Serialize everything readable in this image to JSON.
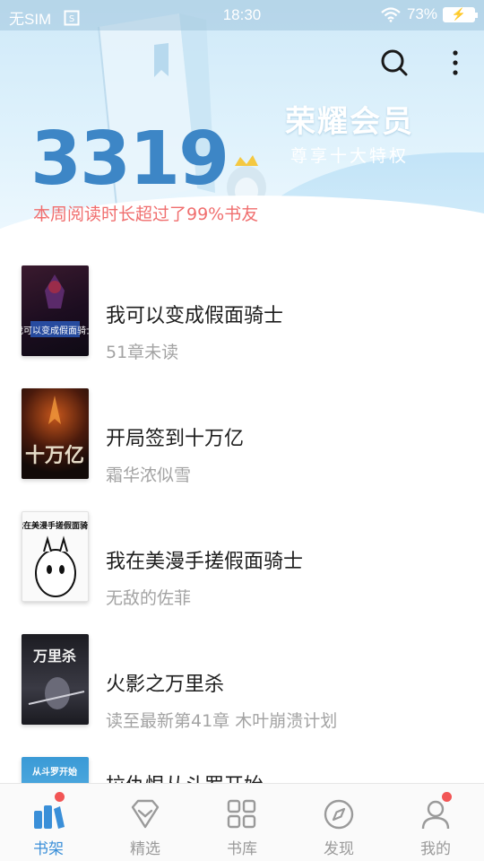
{
  "status_bar": {
    "carrier": "无SIM",
    "time": "18:30",
    "battery": "73%"
  },
  "header": {
    "vip_title": "荣耀会员",
    "vip_subtitle": "尊享十大特权",
    "reading_minutes": "3319",
    "reading_rank_text": "本周阅读时长超过了99%书友"
  },
  "books": [
    {
      "title": "我可以变成假面骑士",
      "subtitle": "51章未读",
      "cover_text": "我可以变成假面骑士"
    },
    {
      "title": "开局签到十万亿",
      "subtitle": "霜华浓似雪",
      "cover_text": "十万亿"
    },
    {
      "title": "我在美漫手搓假面骑士",
      "subtitle": "无敌的佐菲",
      "cover_text": "我在美漫手搓假面骑士"
    },
    {
      "title": "火影之万里杀",
      "subtitle": "读至最新第41章 木叶崩溃计划",
      "cover_text": "万里杀"
    },
    {
      "title": "拉仇恨从斗罗开始",
      "subtitle": "",
      "cover_text": "从斗罗开始"
    }
  ],
  "tabs": [
    {
      "label": "书架",
      "icon": "bookshelf-icon",
      "active": true,
      "badge": true
    },
    {
      "label": "精选",
      "icon": "diamond-icon",
      "active": false,
      "badge": false
    },
    {
      "label": "书库",
      "icon": "grid-icon",
      "active": false,
      "badge": false
    },
    {
      "label": "发现",
      "icon": "compass-icon",
      "active": false,
      "badge": false
    },
    {
      "label": "我的",
      "icon": "user-icon",
      "active": false,
      "badge": true
    }
  ],
  "colors": {
    "accent": "#3a8fd8",
    "minutes": "#3d86c6",
    "rank_text": "#f06e6e",
    "badge": "#f25555"
  }
}
